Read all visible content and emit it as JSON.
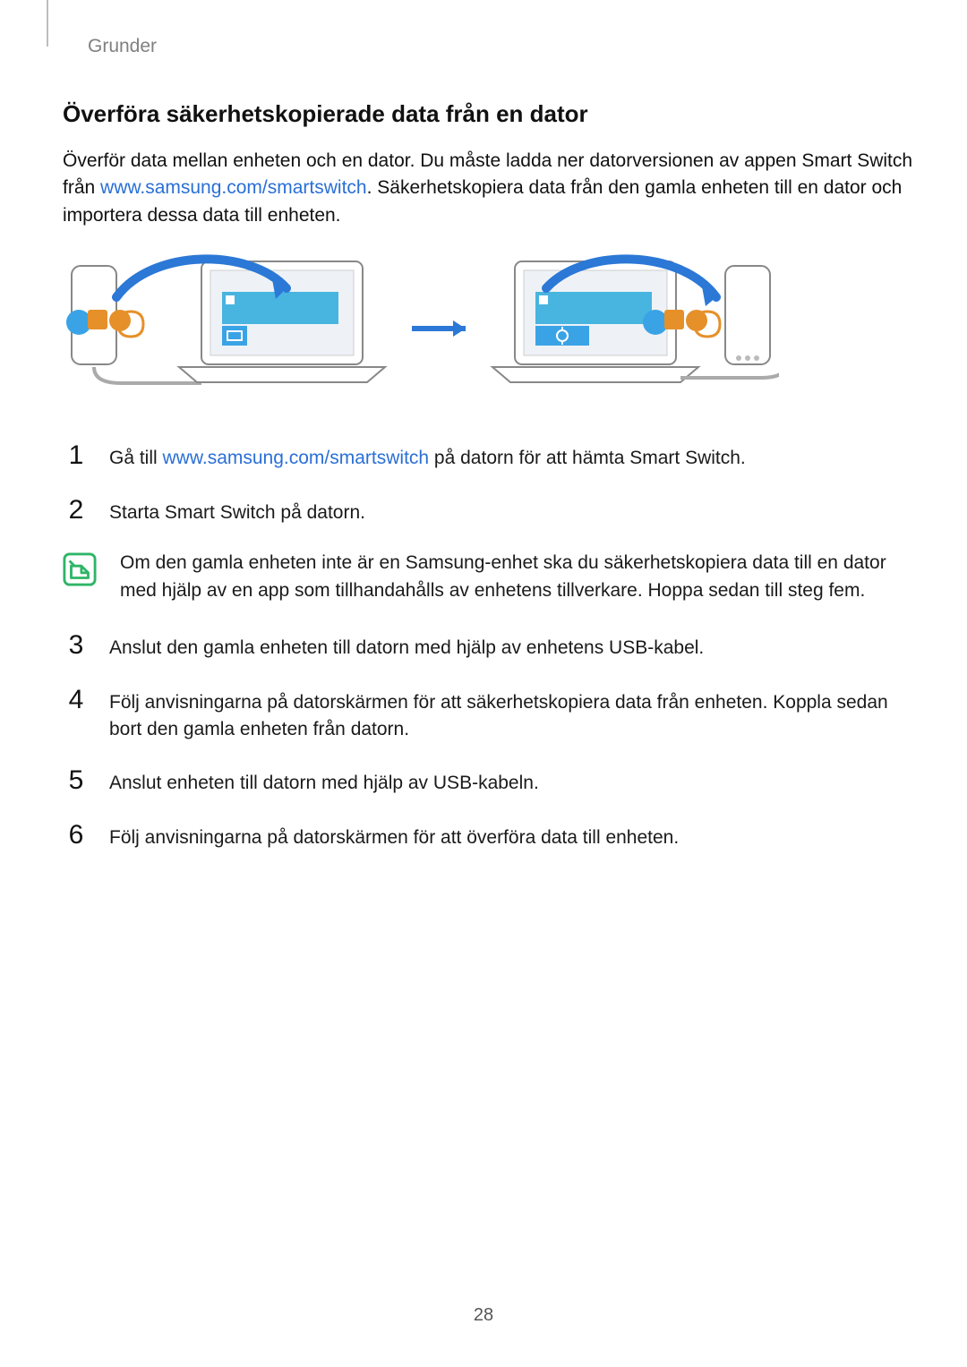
{
  "header": {
    "section_label": "Grunder"
  },
  "title": "Överföra säkerhetskopierade data från en dator",
  "intro": {
    "before_link": "Överför data mellan enheten och en dator. Du måste ladda ner datorversionen av appen Smart Switch från ",
    "link_text": "www.samsung.com/smartswitch",
    "after_link": ". Säkerhetskopiera data från den gamla enheten till en dator och importera dessa data till enheten."
  },
  "steps": {
    "s1": {
      "num": "1",
      "before_link": "Gå till ",
      "link_text": "www.samsung.com/smartswitch",
      "after_link": " på datorn för att hämta Smart Switch."
    },
    "s2": {
      "num": "2",
      "text": "Starta Smart Switch på datorn."
    },
    "s3": {
      "num": "3",
      "text": "Anslut den gamla enheten till datorn med hjälp av enhetens USB-kabel."
    },
    "s4": {
      "num": "4",
      "text": "Följ anvisningarna på datorskärmen för att säkerhetskopiera data från enheten. Koppla sedan bort den gamla enheten från datorn."
    },
    "s5": {
      "num": "5",
      "text": "Anslut enheten till datorn med hjälp av USB-kabeln."
    },
    "s6": {
      "num": "6",
      "text": "Följ anvisningarna på datorskärmen för att överföra data till enheten."
    }
  },
  "note": {
    "text": "Om den gamla enheten inte är en Samsung-enhet ska du säkerhetskopiera data till en dator med hjälp av en app som tillhandahålls av enhetens tillverkare. Hoppa sedan till steg fem."
  },
  "page_number": "28"
}
